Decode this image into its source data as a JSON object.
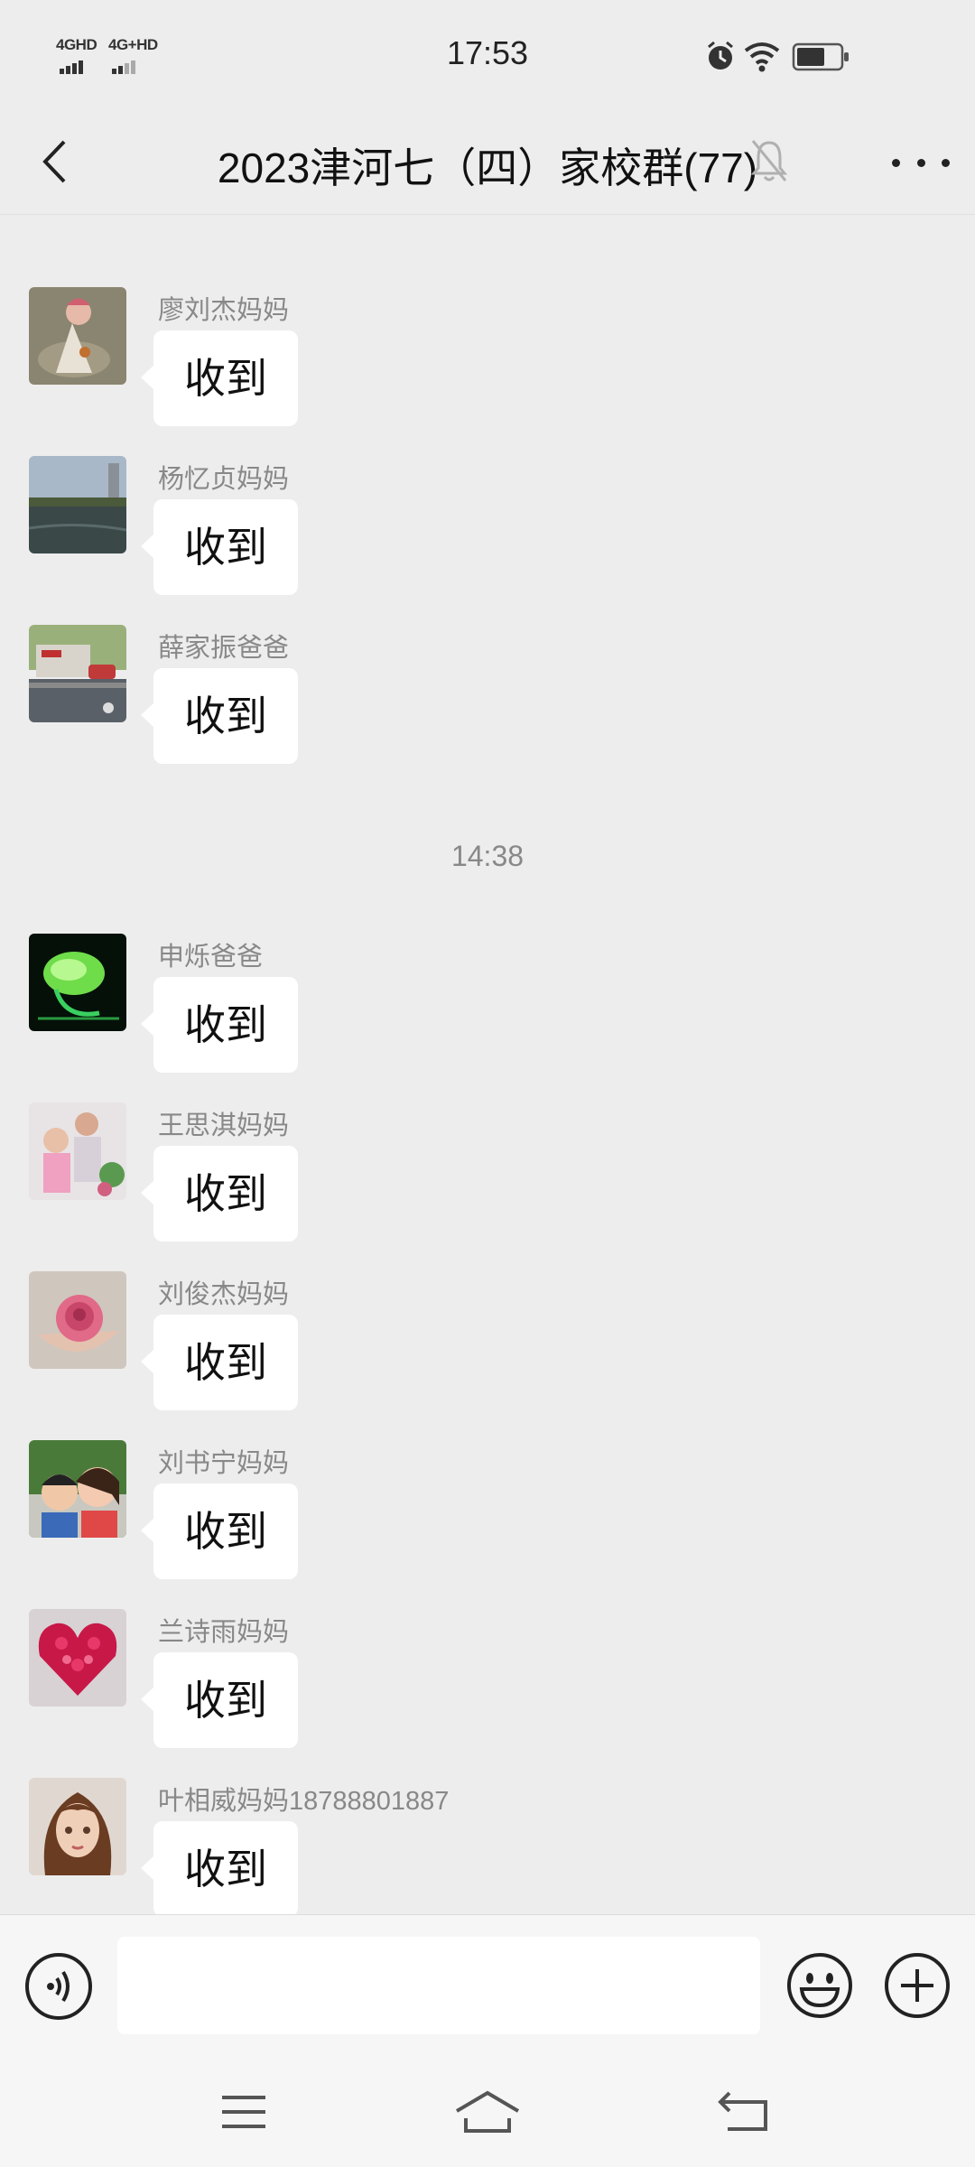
{
  "status_bar": {
    "signal_1": "4GHD",
    "signal_2": "4G+HD",
    "time": "17:53"
  },
  "header": {
    "title": "2023津河七（四）家校群(77)",
    "icons": [
      "back-icon",
      "mute-bell-icon",
      "more-icon"
    ]
  },
  "chat": {
    "timestamp": "14:38",
    "partial_message": {
      "text": "收到"
    },
    "messages": [
      {
        "sender": "廖刘杰妈妈",
        "text": "收到"
      },
      {
        "sender": "杨忆贞妈妈",
        "text": "收到"
      },
      {
        "sender": "薛家振爸爸",
        "text": "收到"
      },
      {
        "sender": "申烁爸爸",
        "text": "收到"
      },
      {
        "sender": "王思淇妈妈",
        "text": "收到"
      },
      {
        "sender": "刘俊杰妈妈",
        "text": "收到"
      },
      {
        "sender": "刘书宁妈妈",
        "text": "收到"
      },
      {
        "sender": "兰诗雨妈妈",
        "text": "收到"
      },
      {
        "sender": "叶相威妈妈18788801887",
        "text": "收到"
      }
    ]
  },
  "input_bar": {
    "value": "",
    "icons": [
      "voice-icon",
      "emoji-icon",
      "plus-icon"
    ]
  },
  "nav_bar": {
    "icons": [
      "menu-icon",
      "home-icon",
      "back-nav-icon"
    ]
  },
  "colors": {
    "background": "#ededed",
    "bubble": "#ffffff",
    "sender_text": "#888888",
    "bar": "#f6f6f6"
  }
}
